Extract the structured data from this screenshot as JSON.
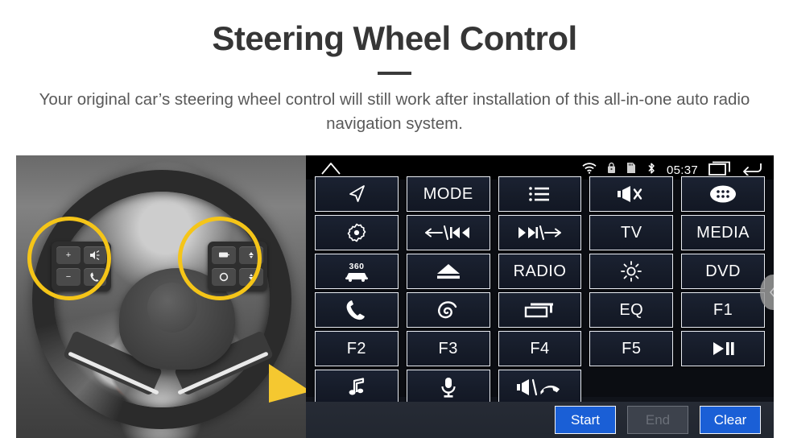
{
  "header": {
    "title": "Steering Wheel Control",
    "subtitle": "Your original car’s steering wheel control will still work after installation of this all-in-one auto radio navigation system."
  },
  "photo": {
    "description": "steering-wheel-photo",
    "highlight_color": "#f5c518",
    "left_pad_keys": [
      "+",
      "−",
      "volume-mode-icon",
      "call-icon"
    ],
    "right_pad_keys": [
      "display-icon",
      "up-icon",
      "circle-icon",
      "down-icon"
    ]
  },
  "head_unit": {
    "statusbar": {
      "home_icon": "home-icon",
      "icons": [
        "wifi-icon",
        "lock-icon",
        "sd-card-icon",
        "bluetooth-icon"
      ],
      "time": "05:37",
      "recents_icon": "recents-icon",
      "back_icon": "back-icon"
    },
    "grid": {
      "rows": [
        [
          {
            "label": "",
            "icon": "navigation-arrow-icon",
            "name": "navigation"
          },
          {
            "label": "MODE",
            "icon": "",
            "name": "mode"
          },
          {
            "label": "",
            "icon": "list-icon",
            "name": "list"
          },
          {
            "label": "",
            "icon": "mute-icon",
            "name": "mute"
          },
          {
            "label": "",
            "icon": "apps-grid-icon",
            "name": "apps"
          }
        ],
        [
          {
            "label": "",
            "icon": "settings-gear-icon",
            "name": "settings"
          },
          {
            "label": "",
            "icon": "previous-track-icon",
            "name": "previous"
          },
          {
            "label": "",
            "icon": "next-track-icon",
            "name": "next"
          },
          {
            "label": "TV",
            "icon": "",
            "name": "tv"
          },
          {
            "label": "MEDIA",
            "icon": "",
            "name": "media"
          }
        ],
        [
          {
            "label": "",
            "icon": "car-360-icon",
            "name": "camera-360"
          },
          {
            "label": "",
            "icon": "eject-icon",
            "name": "eject"
          },
          {
            "label": "RADIO",
            "icon": "",
            "name": "radio"
          },
          {
            "label": "",
            "icon": "brightness-icon",
            "name": "brightness"
          },
          {
            "label": "DVD",
            "icon": "",
            "name": "dvd"
          }
        ],
        [
          {
            "label": "",
            "icon": "phone-icon",
            "name": "phone"
          },
          {
            "label": "",
            "icon": "swirl-icon",
            "name": "swirl"
          },
          {
            "label": "",
            "icon": "windows-icon",
            "name": "windows"
          },
          {
            "label": "EQ",
            "icon": "",
            "name": "eq"
          },
          {
            "label": "F1",
            "icon": "",
            "name": "f1"
          }
        ],
        [
          {
            "label": "F2",
            "icon": "",
            "name": "f2"
          },
          {
            "label": "F3",
            "icon": "",
            "name": "f3"
          },
          {
            "label": "F4",
            "icon": "",
            "name": "f4"
          },
          {
            "label": "F5",
            "icon": "",
            "name": "f5"
          },
          {
            "label": "",
            "icon": "play-pause-icon",
            "name": "play-pause"
          }
        ],
        [
          {
            "label": "",
            "icon": "music-note-icon",
            "name": "music"
          },
          {
            "label": "",
            "icon": "microphone-icon",
            "name": "microphone"
          },
          {
            "label": "",
            "icon": "volume-hangup-icon",
            "name": "volume-hangup"
          },
          {
            "label": "",
            "icon": "",
            "name": "empty-1"
          },
          {
            "label": "",
            "icon": "",
            "name": "empty-2"
          }
        ]
      ]
    },
    "actions": {
      "start_label": "Start",
      "end_label": "End",
      "clear_label": "Clear",
      "end_disabled": true
    },
    "panel_handle_icon": "chevron-left-icon",
    "colors": {
      "button_face": "#1b2232",
      "button_border": "#e9ecf2",
      "accent_blue": "#1a5fd6",
      "disabled_gray": "#3d424c",
      "panel_bg": "#0b0d12"
    }
  }
}
